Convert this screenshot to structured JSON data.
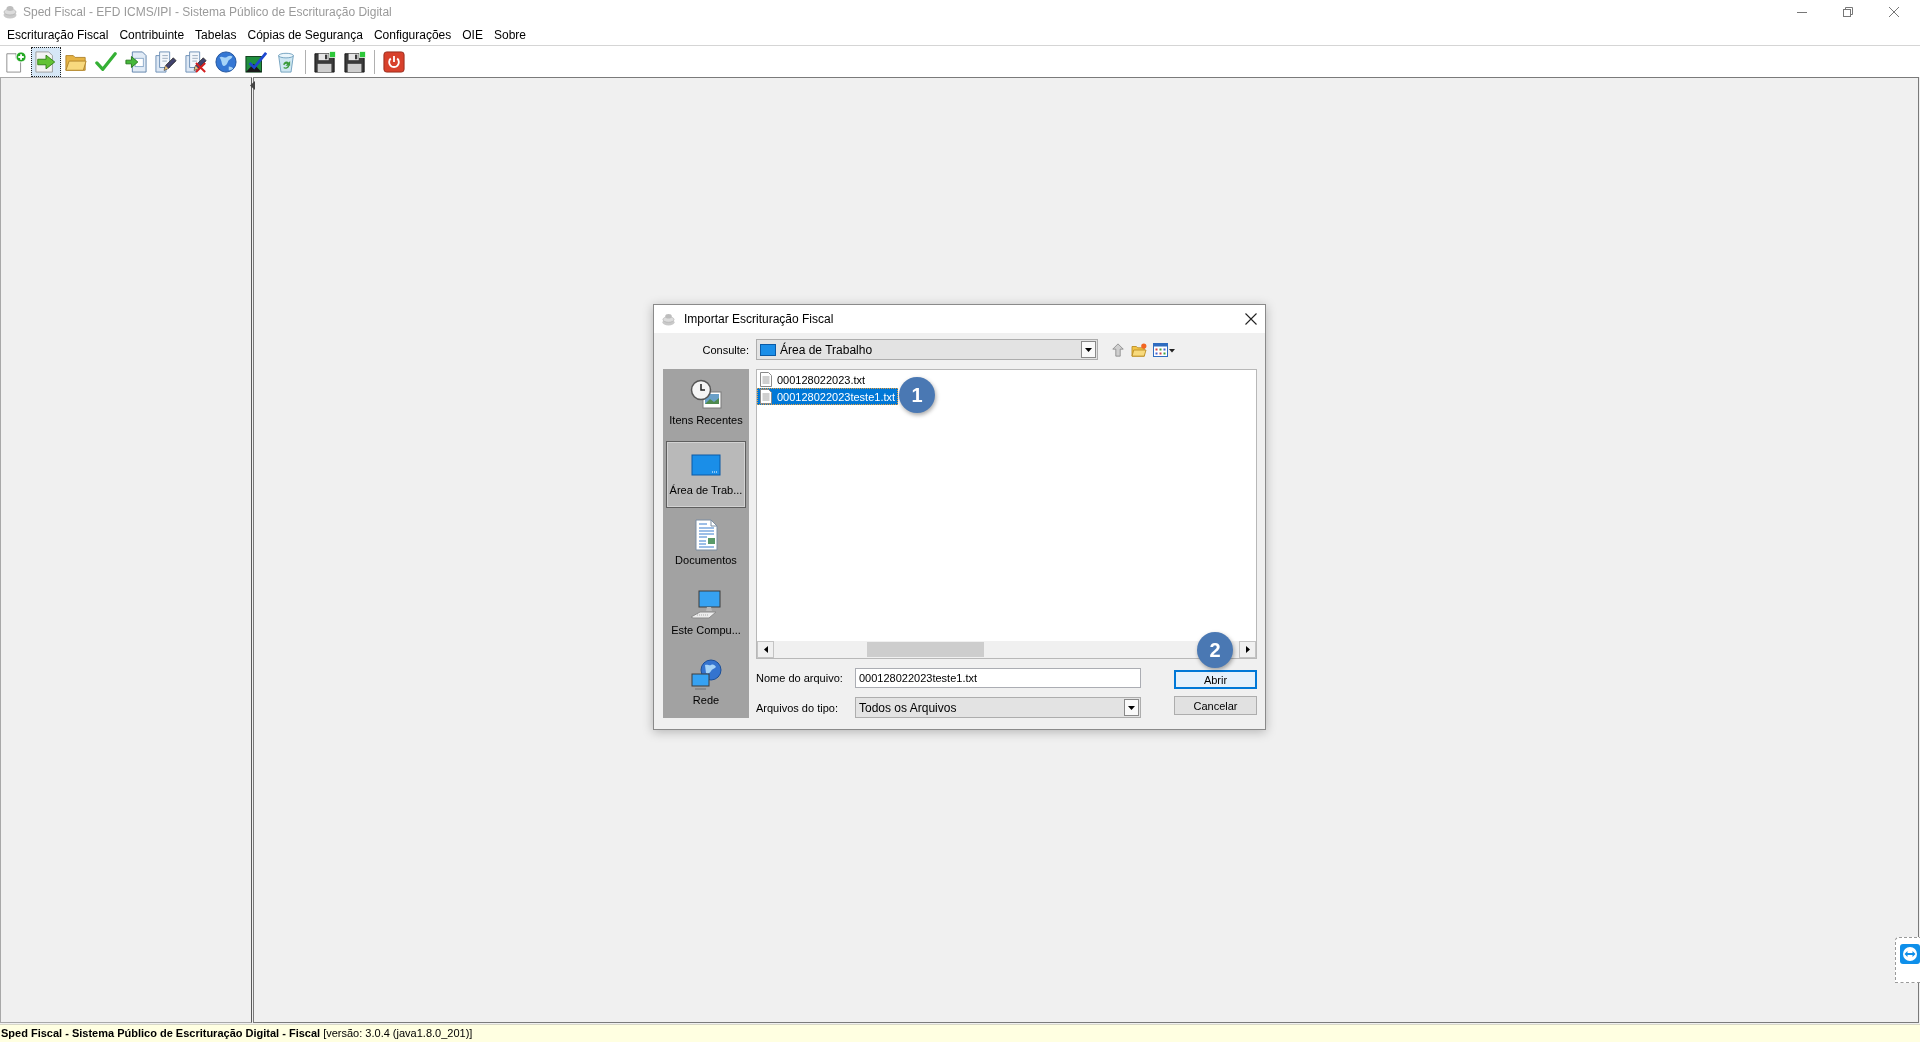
{
  "window": {
    "title": "Sped Fiscal - EFD ICMS/IPI - Sistema Público de Escrituração Digital"
  },
  "menu": [
    "Escrituração Fiscal",
    "Contribuinte",
    "Tabelas",
    "Cópias de Segurança",
    "Configurações",
    "OIE",
    "Sobre"
  ],
  "toolbar": {
    "groups": [
      {
        "buttons": [
          {
            "focused": false
          },
          {
            "focused": true
          },
          {
            "focused": false
          },
          {
            "focused": false
          },
          {
            "focused": false
          },
          {
            "focused": false
          },
          {
            "focused": false
          },
          {
            "focused": false
          },
          {
            "focused": false
          },
          {
            "focused": false
          }
        ]
      },
      {
        "buttons": [
          {
            "focused": false
          },
          {
            "focused": false
          }
        ]
      },
      {
        "buttons": [
          {
            "focused": false
          }
        ]
      }
    ]
  },
  "dialog": {
    "title": "Importar Escrituração Fiscal",
    "look_in": {
      "label": "Consulte:",
      "value": "Área de Trabalho"
    },
    "places": [
      {
        "label": "Itens Recentes",
        "selected": false
      },
      {
        "label": "Área de Trab...",
        "selected": true
      },
      {
        "label": "Documentos",
        "selected": false
      },
      {
        "label": "Este Compu...",
        "selected": false
      },
      {
        "label": "Rede",
        "selected": false
      }
    ],
    "files": [
      {
        "name": "000128022023.txt",
        "selected": false
      },
      {
        "name": "000128022023teste1.txt",
        "selected": true
      }
    ],
    "file_name": {
      "label": "Nome do arquivo:",
      "value": "000128022023teste1.txt"
    },
    "file_type": {
      "label": "Arquivos do tipo:",
      "value": "Todos os Arquivos"
    },
    "buttons": [
      {
        "label": "Abrir",
        "focused": true
      },
      {
        "label": "Cancelar",
        "focused": false
      }
    ]
  },
  "callouts": [
    {
      "label": "1"
    },
    {
      "label": "2"
    }
  ],
  "status_bar": {
    "text": "**Sped Fiscal - Sistema Público de Escrituração Digital - Fiscal** [versão: 3.0.4 (java1.8.0_201)]"
  }
}
